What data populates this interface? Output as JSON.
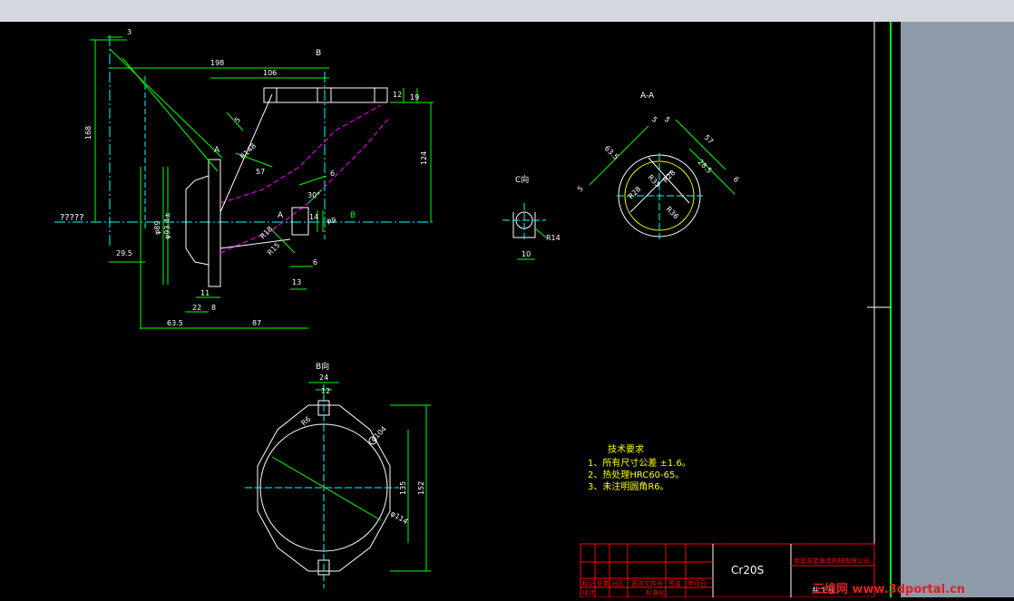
{
  "drawing": {
    "left_view": {
      "dims": {
        "d3": "3",
        "d198": "198",
        "d106": "106",
        "d168": "168",
        "d12": "12",
        "d19": "19",
        "d124": "124",
        "dR148": "R148",
        "d57": "57",
        "d5": "5",
        "d6": "6",
        "d6b": "6",
        "d30": "30°",
        "d14": "14",
        "dphi9": "φ9",
        "d13": "13",
        "d11": "11",
        "d22": "22",
        "d8": "8",
        "d63_5": "63.5",
        "d87": "87",
        "d29_5": "29.5",
        "dphi89": "φ89",
        "dphi93": "φ93.4±",
        "dR18": "R18",
        "dR15": "R15",
        "qq": "?????",
        "qcol": "?\n?\n?\n?\n?\n?"
      },
      "labels": {
        "B_top": "B",
        "A_top": "A",
        "A_mid": "A",
        "B_arrow": "B"
      }
    },
    "c_view": {
      "title": "C向",
      "d10": "10",
      "dR14": "R14"
    },
    "a_view": {
      "title": "A-A",
      "dims": {
        "d63_5": "63.5",
        "d5a": "5",
        "d5b": "5",
        "d57": "57",
        "d28_5": "28.5",
        "d6": "6",
        "d5c": "5",
        "dR28": "R28",
        "dR28b": "R28",
        "dR36": "R36",
        "dR35": "R35"
      }
    },
    "b_view": {
      "title": "B向",
      "dims": {
        "d24": "24",
        "d12": "12",
        "dR6": "R6",
        "dphi104": "φ104",
        "d135": "135",
        "d152": "152",
        "dphi114": "φ114"
      }
    },
    "notes": {
      "title": "技术要求",
      "lines": [
        "1、所有尺寸公差 ±1.6。",
        "2、热处理HRC60-65。",
        "3、未注明圆角R6。"
      ]
    },
    "title_block": {
      "material": "Cr20S",
      "company": "南昌双星铸造机械有限公司",
      "headers": [
        "标记",
        "处数",
        "分区",
        "更改文件号",
        "签名",
        "年月日"
      ],
      "row2": [
        "设计",
        "",
        "",
        "标准化",
        ""
      ],
      "right": "共 1 张"
    }
  },
  "watermark": {
    "text": "三维网",
    "url": "www.3dportal.cn"
  },
  "colors": {
    "green": "#00ff00",
    "white": "#ffffff",
    "magenta": "#ff00ff",
    "cyan": "#00ffff",
    "yellow": "#ffff00",
    "red": "#ff0000"
  }
}
